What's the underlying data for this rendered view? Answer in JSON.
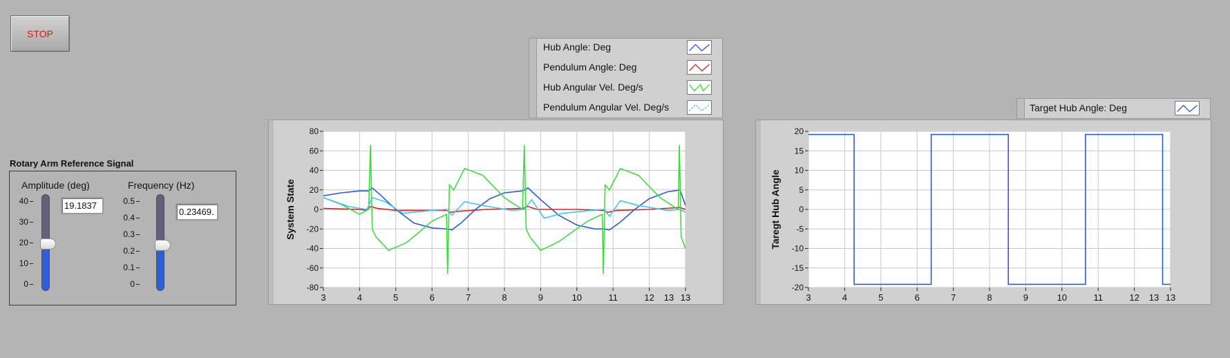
{
  "stop_button": {
    "label": "STOP",
    "color": "#e81010"
  },
  "reference": {
    "title": "Rotary Arm Reference Signal",
    "amplitude": {
      "label": "Amplitude (deg)",
      "value_text": "19.1837",
      "value": 19.1837,
      "min": 0,
      "max": 40,
      "ticks": [
        "40",
        "30",
        "20",
        "10",
        "0"
      ]
    },
    "frequency": {
      "label": "Frequency (Hz)",
      "value_text": "0.23469․",
      "value": 0.2347,
      "min": 0,
      "max": 0.5,
      "ticks": [
        "0.5",
        "0.4",
        "0.3",
        "0.2",
        "0.1",
        "0"
      ]
    }
  },
  "legend_state": {
    "items": [
      {
        "label": "Hub Angle: Deg",
        "color": "#2a5bd7"
      },
      {
        "label": "Pendulum Angle: Deg",
        "color": "#e02020"
      },
      {
        "label": "Hub Angular Vel. Deg/s",
        "color": "#3cdc3c"
      },
      {
        "label": "Pendulum Angular Vel. Deg/s",
        "color": "#3ec8ee"
      }
    ]
  },
  "legend_target": {
    "items": [
      {
        "label": "Target Hub Angle: Deg",
        "color": "#2a5bd7"
      }
    ]
  },
  "chart_data": [
    {
      "type": "line",
      "title": "",
      "ylabel": "System State",
      "xlabel": "",
      "xlim": [
        3,
        13
      ],
      "ylim": [
        -80,
        80
      ],
      "x_ticks": [
        "3",
        "4",
        "5",
        "6",
        "7",
        "8",
        "9",
        "10",
        "11",
        "12",
        "13",
        "13"
      ],
      "y_ticks": [
        "80",
        "60",
        "40",
        "20",
        "0",
        "-20",
        "-40",
        "-60",
        "-80"
      ],
      "grid": true,
      "series": [
        {
          "name": "Hub Angle: Deg",
          "color": "#2a5bd7",
          "x": [
            3,
            3.5,
            4,
            4.25,
            4.35,
            4.6,
            5,
            5.5,
            6,
            6.4,
            6.55,
            6.8,
            7.2,
            7.6,
            8,
            8.5,
            8.65,
            9,
            9.5,
            10,
            10.5,
            10.75,
            10.9,
            11.2,
            11.6,
            12,
            12.5,
            12.85,
            13
          ],
          "values": [
            14,
            17,
            19,
            19,
            22,
            14,
            0,
            -14,
            -19,
            -20,
            -21,
            -14,
            0,
            11,
            17,
            19,
            22,
            10,
            -6,
            -16,
            -20,
            -20,
            -21,
            -13,
            0,
            11,
            18,
            20,
            4
          ]
        },
        {
          "name": "Pendulum Angle: Deg",
          "color": "#e02020",
          "x": [
            3,
            4,
            4.2,
            4.3,
            4.5,
            5,
            6,
            6.4,
            6.5,
            6.7,
            7.5,
            8.5,
            8.65,
            8.9,
            10,
            10.75,
            10.85,
            11.1,
            12,
            12.85,
            13
          ],
          "values": [
            1,
            0,
            -1,
            3,
            1,
            -1,
            -1,
            -1,
            -3,
            -2,
            0,
            1,
            3,
            0,
            0,
            -1,
            -3,
            -1,
            0,
            2,
            0
          ]
        },
        {
          "name": "Hub Angular Vel. Deg/s",
          "color": "#3cdc3c",
          "x": [
            3,
            3.5,
            4,
            4.25,
            4.3,
            4.35,
            4.45,
            4.8,
            5.3,
            6,
            6.4,
            6.43,
            6.48,
            6.6,
            6.9,
            7.4,
            8,
            8.5,
            8.55,
            8.6,
            8.7,
            9,
            9.5,
            10.3,
            10.7,
            10.73,
            10.78,
            10.9,
            11.2,
            11.7,
            12.3,
            12.8,
            12.83,
            12.88,
            13
          ],
          "values": [
            12,
            5,
            -5,
            0,
            66,
            -20,
            -28,
            -42,
            -34,
            -12,
            -5,
            -66,
            25,
            20,
            42,
            35,
            12,
            0,
            66,
            -20,
            -28,
            -42,
            -33,
            -12,
            -5,
            -66,
            25,
            20,
            42,
            35,
            12,
            0,
            66,
            -28,
            -40
          ]
        },
        {
          "name": "Pendulum Angular Vel. Deg/s",
          "color": "#3ec8ee",
          "x": [
            3,
            3.7,
            4.2,
            4.35,
            4.7,
            5.2,
            6,
            6.4,
            6.55,
            6.9,
            7.4,
            8.2,
            8.55,
            8.75,
            9.1,
            9.6,
            10.4,
            10.75,
            10.9,
            11.2,
            11.7,
            12.5,
            12.85,
            13
          ],
          "values": [
            12,
            3,
            0,
            12,
            8,
            -4,
            -1,
            0,
            -6,
            8,
            4,
            -1,
            0,
            10,
            -9,
            -4,
            -1,
            0,
            -7,
            9,
            4,
            -1,
            0,
            -3
          ]
        }
      ]
    },
    {
      "type": "line",
      "title": "",
      "ylabel": "Taregt Hub Angle",
      "xlabel": "",
      "xlim": [
        3,
        13
      ],
      "ylim": [
        -20,
        20
      ],
      "x_ticks": [
        "3",
        "4",
        "5",
        "6",
        "7",
        "8",
        "9",
        "10",
        "11",
        "12",
        "13",
        "13"
      ],
      "y_ticks": [
        "20",
        "15",
        "10",
        "5",
        "0",
        "-5",
        "-10",
        "-15",
        "-20"
      ],
      "grid": true,
      "series": [
        {
          "name": "Target Hub Angle: Deg",
          "color": "#2a5bd7",
          "x": [
            3,
            4.26,
            4.26,
            6.39,
            6.39,
            8.52,
            8.52,
            10.65,
            10.65,
            12.78,
            12.78,
            13
          ],
          "values": [
            19.18,
            19.18,
            -19.18,
            -19.18,
            19.18,
            19.18,
            -19.18,
            -19.18,
            19.18,
            19.18,
            -19.18,
            -19.18
          ]
        }
      ]
    }
  ]
}
